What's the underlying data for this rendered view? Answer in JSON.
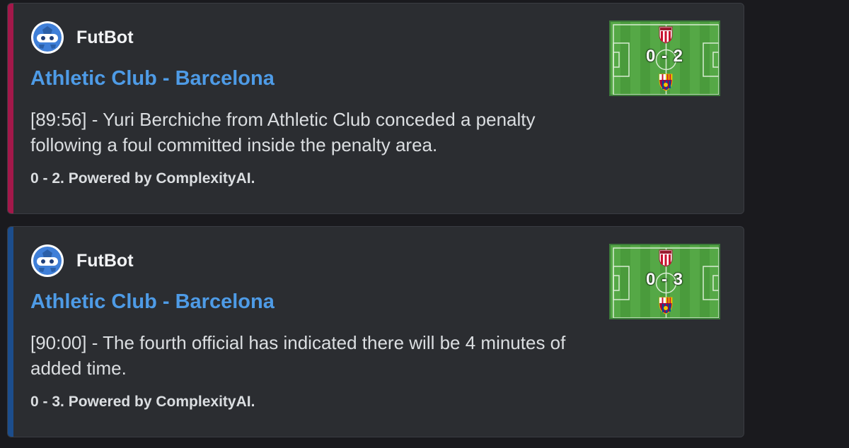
{
  "messages": [
    {
      "accent_color": "#a3184a",
      "author": "FutBot",
      "title": "Athletic Club - Barcelona",
      "description": "[89:56] - Yuri Berchiche from Athletic Club conceded a penalty following a foul committed inside the penalty area.",
      "footer": "0 - 2. Powered by ComplexityAI.",
      "thumbnail": {
        "home_score": "0",
        "separator": "-",
        "away_score": "2",
        "home_crest": "athletic-club-crest-icon",
        "away_crest": "barcelona-crest-icon"
      }
    },
    {
      "accent_color": "#1c4d8c",
      "author": "FutBot",
      "title": "Athletic Club - Barcelona",
      "description": "[90:00] - The fourth official has indicated there will be 4 minutes of added time.",
      "footer": "0 - 3. Powered by ComplexityAI.",
      "thumbnail": {
        "home_score": "0",
        "separator": "-",
        "away_score": "3",
        "home_crest": "athletic-club-crest-icon",
        "away_crest": "barcelona-crest-icon"
      }
    }
  ],
  "colors": {
    "background": "#1a1a1e",
    "embed_background": "#2b2d31",
    "title_link": "#4e9be6",
    "pitch_green": "#4a9b3c"
  }
}
